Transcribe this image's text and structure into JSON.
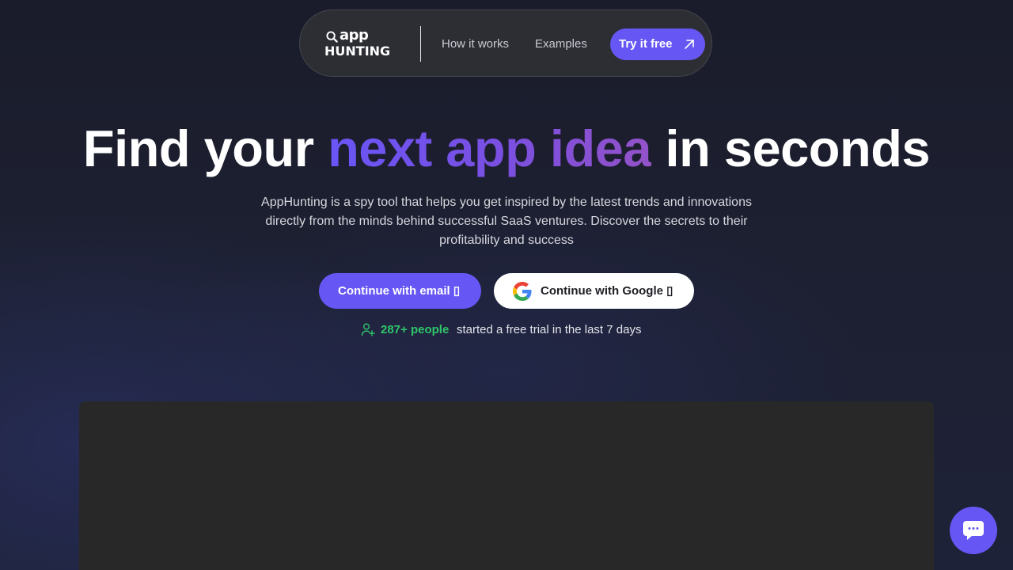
{
  "nav": {
    "logo": {
      "line1": "app",
      "line2": "HUNTING"
    },
    "links": [
      "How it works",
      "Examples"
    ],
    "cta_label": "Try it free"
  },
  "hero": {
    "title_before": "Find your",
    "title_accent": "next app idea",
    "title_after": "in seconds",
    "subtitle": "AppHunting is a spy tool that helps you get inspired by the latest trends and innovations directly from the minds behind successful SaaS ventures. Discover the secrets to their profitability and success"
  },
  "cta": {
    "email_label": "Continue with email ▯",
    "google_label": "Continue with Google ▯"
  },
  "social_proof": {
    "count": "287+ people",
    "text": "started a free trial in the last 7 days"
  },
  "colors": {
    "accent": "#6657f5",
    "proof_green": "#2fc66a",
    "background": "#1d2031",
    "preview": "#282828"
  },
  "icons": {
    "logo": "magnifier-icon",
    "try_button": "arrow-up-right-icon",
    "google": "google-g-icon",
    "social_proof": "user-plus-icon",
    "chat": "chat-bubble-icon"
  }
}
